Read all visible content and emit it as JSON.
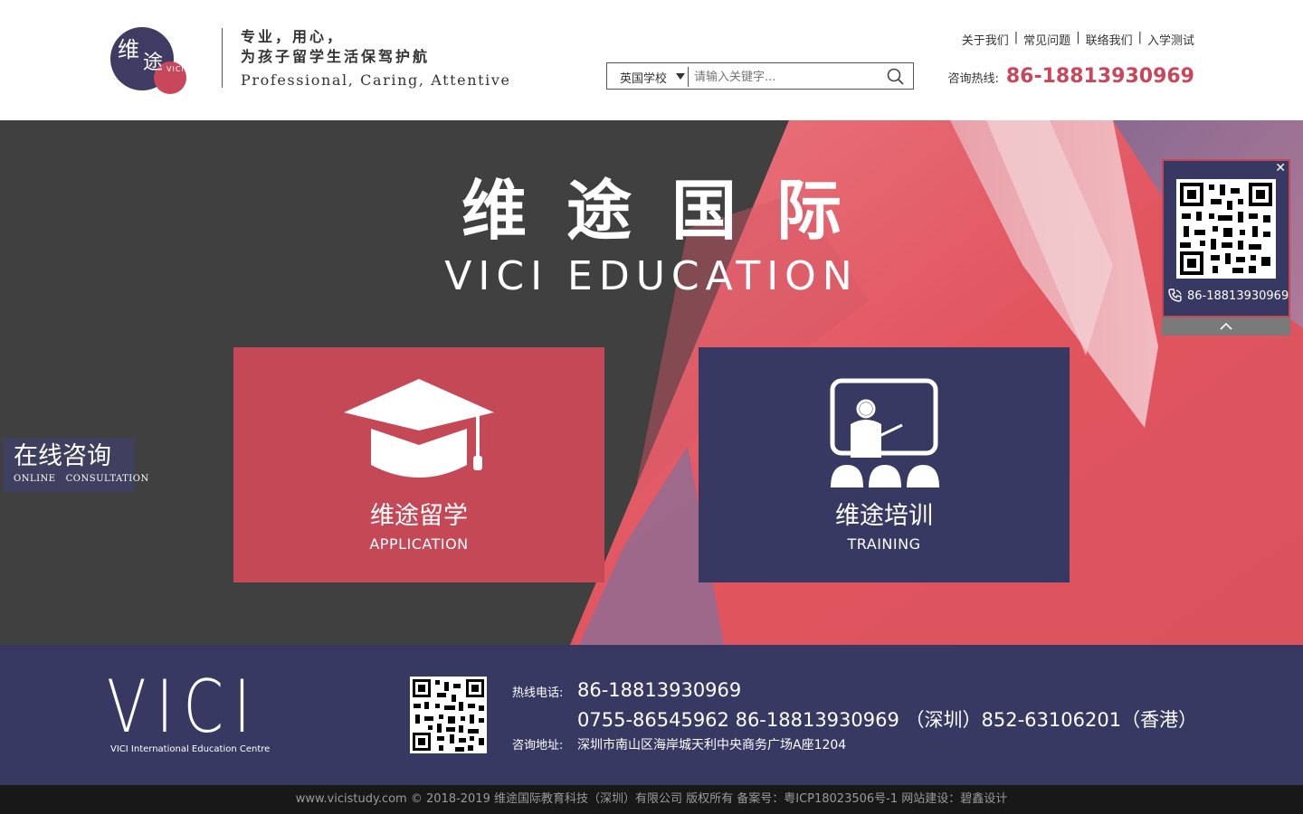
{
  "header": {
    "logo": {
      "char1": "维",
      "char2": "途",
      "mark": "VICI"
    },
    "slogan": {
      "line1": "专业，用心，",
      "line2": "为孩子留学生活保驾护航",
      "line3": "Professional, Caring, Attentive"
    },
    "search": {
      "select_value": "英国学校",
      "placeholder": "请输入关键字...",
      "icon": "search-icon"
    },
    "links": [
      "关于我们",
      "常见问题",
      "联络我们",
      "入学测试"
    ],
    "hotline": {
      "label": "咨询热线:",
      "number": "86-18813930969"
    }
  },
  "hero": {
    "title": "维途国际",
    "subtitle": "VICI EDUCATION",
    "cards": [
      {
        "cn": "维途留学",
        "en": "APPLICATION",
        "icon": "graduation-cap-icon",
        "color": "#c54857"
      },
      {
        "cn": "维途培训",
        "en": "TRAINING",
        "icon": "teacher-board-icon",
        "color": "#383962"
      }
    ],
    "consult": {
      "cn": "在线咨询",
      "en": "ONLINE   CONSULTATION"
    },
    "qr_panel": {
      "close": "✕",
      "phone": "86-18813930969",
      "icon": "phone-icon"
    }
  },
  "footer": {
    "logo": "VICI",
    "logo_sub": "VICI International Education Centre",
    "hotline_label": "热线电话:",
    "hotline1": "86-18813930969",
    "hotline2": "0755-86545962 86-18813930969 （深圳）852-63106201（香港）",
    "address_label": "咨询地址:",
    "address": "深圳市南山区海岸城天利中央商务广场A座1204"
  },
  "copyright": "www.vicistudy.com © 2018-2019 维途国际教育科技（深圳）有限公司 版权所有 备案号：粤ICP18023506号-1   网站建设：碧鑫设计",
  "colors": {
    "brand_red": "#c54857",
    "brand_navy": "#383962",
    "hotline_red": "#c9475a"
  }
}
